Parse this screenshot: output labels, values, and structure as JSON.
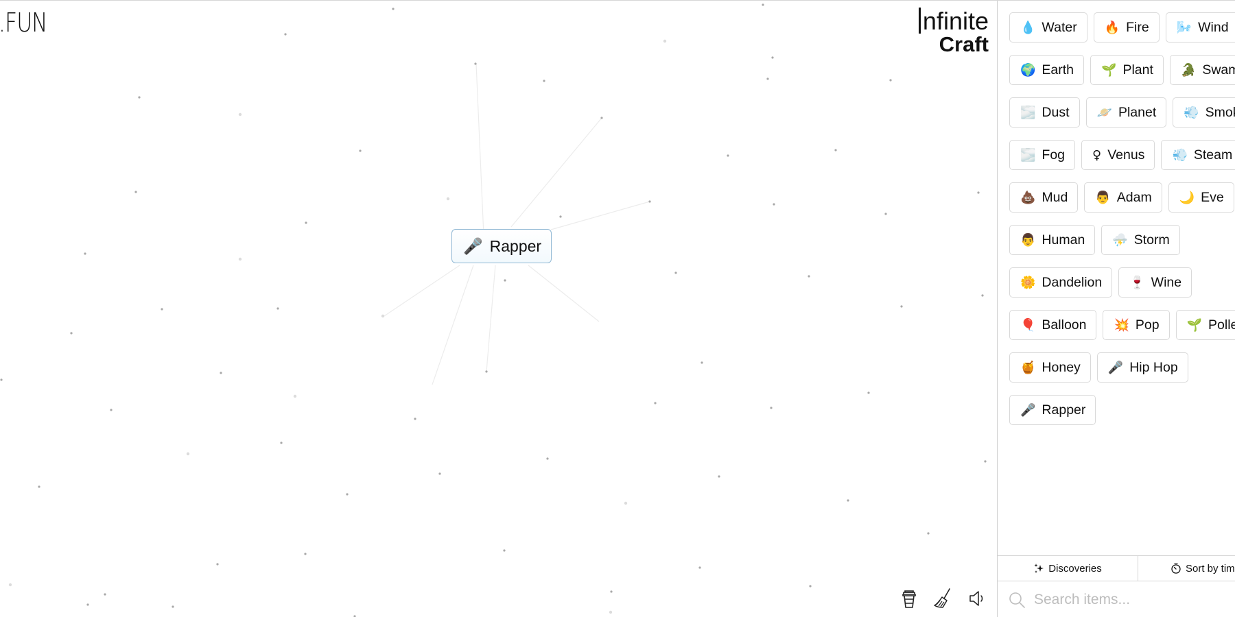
{
  "logo_left": ".FUN",
  "logo_right": {
    "line1": "nfinite",
    "line2": "Craft"
  },
  "canvas": {
    "instance": {
      "emoji": "🎤",
      "label": "Rapper",
      "border_color": "#8fb7d4"
    }
  },
  "tools": [
    {
      "name": "coffee-cup-icon"
    },
    {
      "name": "broom-icon"
    },
    {
      "name": "sound-icon"
    }
  ],
  "sidebar": {
    "items": [
      {
        "emoji": "💧",
        "label": "Water"
      },
      {
        "emoji": "🔥",
        "label": "Fire"
      },
      {
        "emoji": "🌬️",
        "label": "Wind"
      },
      {
        "break": true
      },
      {
        "emoji": "🌍",
        "label": "Earth"
      },
      {
        "emoji": "🌱",
        "label": "Plant"
      },
      {
        "emoji": "🐊",
        "label": "Swamp"
      },
      {
        "break": true
      },
      {
        "emoji": "🌫️",
        "label": "Dust"
      },
      {
        "emoji": "🪐",
        "label": "Planet"
      },
      {
        "emoji": "💨",
        "label": "Smoke"
      },
      {
        "break": true
      },
      {
        "emoji": "🌫️",
        "label": "Fog"
      },
      {
        "emoji": "♀",
        "label": "Venus"
      },
      {
        "emoji": "💨",
        "label": "Steam"
      },
      {
        "break": true
      },
      {
        "emoji": "💩",
        "label": "Mud"
      },
      {
        "emoji": "👨",
        "label": "Adam"
      },
      {
        "emoji": "🌙",
        "label": "Eve"
      },
      {
        "break": true
      },
      {
        "emoji": "👨",
        "label": "Human"
      },
      {
        "emoji": "⛈️",
        "label": "Storm"
      },
      {
        "break": true
      },
      {
        "emoji": "🌼",
        "label": "Dandelion"
      },
      {
        "emoji": "🍷",
        "label": "Wine"
      },
      {
        "break": true
      },
      {
        "emoji": "🎈",
        "label": "Balloon"
      },
      {
        "emoji": "💥",
        "label": "Pop"
      },
      {
        "emoji": "🌱",
        "label": "Pollen"
      },
      {
        "break": true
      },
      {
        "emoji": "🍯",
        "label": "Honey"
      },
      {
        "emoji": "🎤",
        "label": "Hip Hop"
      },
      {
        "break": true
      },
      {
        "emoji": "🎤",
        "label": "Rapper"
      }
    ],
    "tabs": [
      {
        "icon": "sparkle-icon",
        "label": "Discoveries"
      },
      {
        "icon": "clock-icon",
        "label": "Sort by time"
      }
    ],
    "search": {
      "placeholder": "Search items...",
      "value": ""
    }
  }
}
